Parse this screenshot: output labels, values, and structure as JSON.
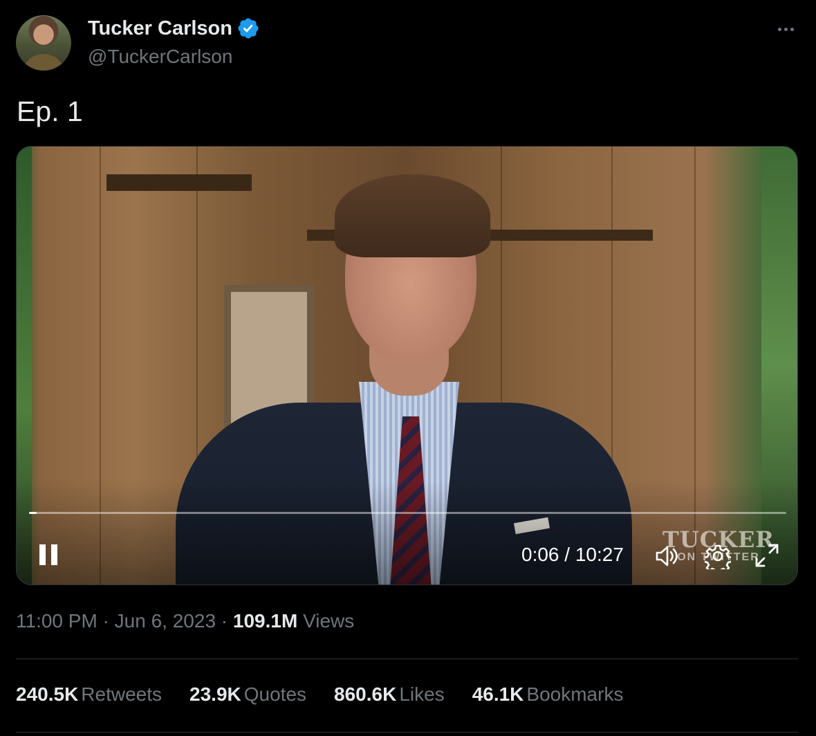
{
  "author": {
    "name": "Tucker Carlson",
    "handle": "@TuckerCarlson",
    "verified": true
  },
  "tweet": {
    "text": "Ep. 1"
  },
  "video": {
    "time_display": "0:06 / 10:27",
    "progress": 0.0096,
    "state": "playing",
    "watermark_main": "TUCKER",
    "watermark_sub": "ON TWITTER"
  },
  "meta": {
    "time": "11:00 PM",
    "sep1": " · ",
    "date": "Jun 6, 2023",
    "sep2": " · ",
    "views_count": "109.1M",
    "views_label": " Views"
  },
  "stats": [
    {
      "count": "240.5K",
      "label": "Retweets"
    },
    {
      "count": "23.9K",
      "label": "Quotes"
    },
    {
      "count": "860.6K",
      "label": "Likes"
    },
    {
      "count": "46.1K",
      "label": "Bookmarks"
    }
  ],
  "colors": {
    "background": "#000000",
    "primary_text": "#e7e9ea",
    "secondary_text": "#71767b",
    "verified_blue": "#1d9bf0",
    "divider": "#2f3336"
  }
}
